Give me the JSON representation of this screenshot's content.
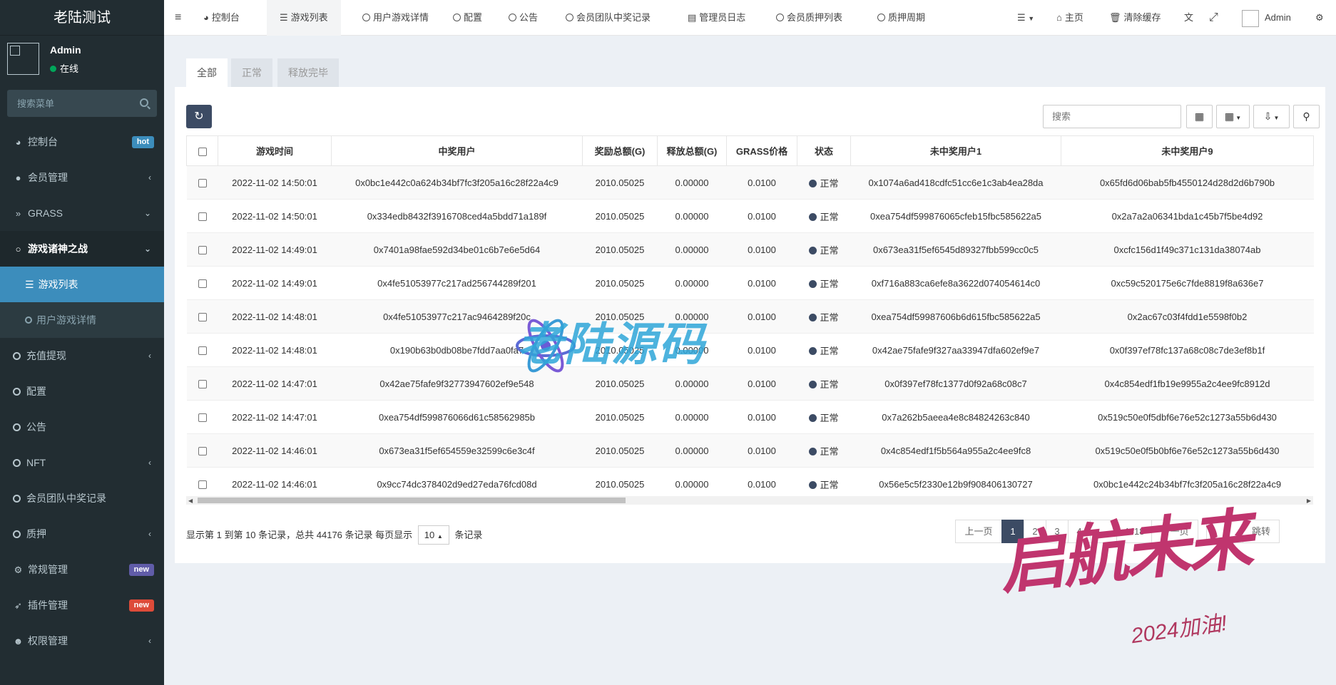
{
  "app": {
    "title": "老陆测试"
  },
  "user": {
    "name": "Admin",
    "status": "在线"
  },
  "sidebar": {
    "search_placeholder": "搜索菜单",
    "items": [
      {
        "label": "控制台",
        "badge": "hot",
        "badge_color": "#3c8dbc"
      },
      {
        "label": "会员管理"
      },
      {
        "label": "GRASS"
      },
      {
        "label": "游戏诸神之战"
      },
      {
        "label": "游戏列表"
      },
      {
        "label": "用户游戏详情"
      },
      {
        "label": "充值提现"
      },
      {
        "label": "配置"
      },
      {
        "label": "公告"
      },
      {
        "label": "NFT"
      },
      {
        "label": "会员团队中奖记录"
      },
      {
        "label": "质押"
      },
      {
        "label": "常规管理",
        "badge": "new",
        "badge_color": "#605ca8"
      },
      {
        "label": "插件管理",
        "badge": "new",
        "badge_color": "#dd4b39"
      },
      {
        "label": "权限管理"
      }
    ]
  },
  "topnav": {
    "tabs": [
      "控制台",
      "游戏列表",
      "用户游戏详情",
      "配置",
      "公告",
      "会员团队中奖记录",
      "管理员日志",
      "会员质押列表",
      "质押周期"
    ],
    "home": "主页",
    "clear_cache": "清除缓存",
    "admin": "Admin"
  },
  "filter_tabs": [
    "全部",
    "正常",
    "释放完毕"
  ],
  "toolbar": {
    "search_placeholder": "搜索"
  },
  "table": {
    "headers": [
      "游戏时间",
      "中奖用户",
      "奖励总额(G)",
      "释放总额(G)",
      "GRASS价格",
      "状态",
      "未中奖用户1",
      "未中奖用户9"
    ],
    "rows": [
      [
        "2022-11-02 14:50:01",
        "0x0bc1e442c0a624b34bf7fc3f205a16c28f22a4c9",
        "2010.05025",
        "0.00000",
        "0.0100",
        "正常",
        "0x1074a6ad418cdfc51cc6e1c3ab4ea28da",
        "0x65fd6d06bab5fb4550124d28d2d6b790b"
      ],
      [
        "2022-11-02 14:50:01",
        "0x334edb8432f3916708ced4a5bdd71a189f",
        "2010.05025",
        "0.00000",
        "0.0100",
        "正常",
        "0xea754df599876065cfeb15fbc585622a5",
        "0x2a7a2a06341bda1c45b7f5be4d92"
      ],
      [
        "2022-11-02 14:49:01",
        "0x7401a98fae592d34be01c6b7e6e5d64",
        "2010.05025",
        "0.00000",
        "0.0100",
        "正常",
        "0x673ea31f5ef6545d89327fbb599cc0c5",
        "0xcfc156d1f49c371c131da38074ab"
      ],
      [
        "2022-11-02 14:49:01",
        "0x4fe51053977c217ad256744289f201",
        "2010.05025",
        "0.00000",
        "0.0100",
        "正常",
        "0xf716a883ca6efe8a3622d074054614c0",
        "0xc59c520175e6c7fde8819f8a636e7"
      ],
      [
        "2022-11-02 14:48:01",
        "0x4fe51053977c217ac9464289f20c",
        "2010.05025",
        "0.00000",
        "0.0100",
        "正常",
        "0xea754df59987606b6d615fbc585622a5",
        "0x2ac67c03f4fdd1e5598f0b2"
      ],
      [
        "2022-11-02 14:48:01",
        "0x190b63b0db08be7fdd7aa0fa7",
        "2010.05025",
        "0.00000",
        "0.0100",
        "正常",
        "0x42ae75fafe9f327aa33947dfa602ef9e7",
        "0x0f397ef78fc137a68c08c7de3ef8b1f"
      ],
      [
        "2022-11-02 14:47:01",
        "0x42ae75fafe9f32773947602ef9e548",
        "2010.05025",
        "0.00000",
        "0.0100",
        "正常",
        "0x0f397ef78fc1377d0f92a68c08c7",
        "0x4c854edf1fb19e9955a2c4ee9fc8912d"
      ],
      [
        "2022-11-02 14:47:01",
        "0xea754df599876066d61c58562985b",
        "2010.05025",
        "0.00000",
        "0.0100",
        "正常",
        "0x7a262b5aeea4e8c84824263c840",
        "0x519c50e0f5dbf6e76e52c1273a55b6d430"
      ],
      [
        "2022-11-02 14:46:01",
        "0x673ea31f5ef654559e32599c6e3c4f",
        "2010.05025",
        "0.00000",
        "0.0100",
        "正常",
        "0x4c854edf1f5b564a955a2c4ee9fc8",
        "0x519c50e0f5b0bf6e76e52c1273a55b6d430"
      ],
      [
        "2022-11-02 14:46:01",
        "0x9cc74dc378402d9ed27eda76fcd08d",
        "2010.05025",
        "0.00000",
        "0.0100",
        "正常",
        "0x56e5c5f2330e12b9f908406130727",
        "0x0bc1e442c24b34bf7fc3f205a16c28f22a4c9"
      ]
    ]
  },
  "pagination": {
    "info_pre": "显示第 1 到第 10 条记录，总共 44176 条记录 每页显示",
    "page_size": "10",
    "info_post": "条记录",
    "prev": "上一页",
    "pages": [
      "1",
      "2",
      "3",
      "4",
      "...",
      "4418"
    ],
    "next": "下一页",
    "jump": "跳转"
  },
  "watermarks": {
    "w1": "老陆源码",
    "w2": "启航未来",
    "w3": "2024加油!"
  }
}
